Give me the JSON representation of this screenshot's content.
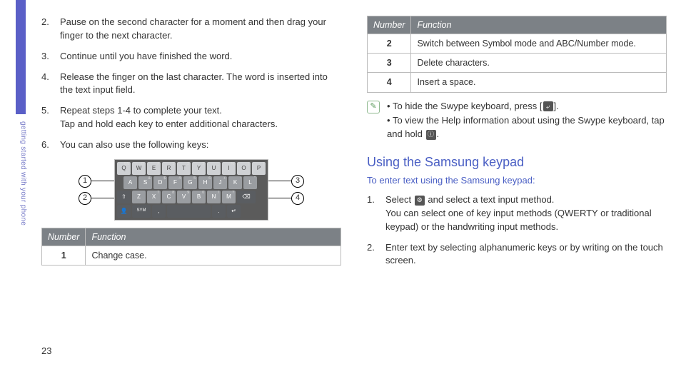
{
  "sidebar": {
    "label": "getting started with your phone"
  },
  "pageNumber": "23",
  "left": {
    "steps": [
      {
        "n": "2.",
        "t": "Pause on the second character for a moment and then drag your finger to the next character."
      },
      {
        "n": "3.",
        "t": "Continue until you have finished the word."
      },
      {
        "n": "4.",
        "t": "Release the finger on the last character. The word is inserted into the text input field."
      },
      {
        "n": "5.",
        "t": "Repeat steps 1-4 to complete your text.\nTap and hold each key to enter additional characters."
      },
      {
        "n": "6.",
        "t": "You can also use the following keys:"
      }
    ],
    "callouts": {
      "c1": "1",
      "c2": "2",
      "c3": "3",
      "c4": "4"
    },
    "table": {
      "hNum": "Number",
      "hFn": "Function",
      "rows": [
        {
          "n": "1",
          "f": "Change case."
        }
      ]
    }
  },
  "right": {
    "table": {
      "hNum": "Number",
      "hFn": "Function",
      "rows": [
        {
          "n": "2",
          "f": "Switch between Symbol mode and ABC/Number mode."
        },
        {
          "n": "3",
          "f": "Delete characters."
        },
        {
          "n": "4",
          "f": "Insert a space."
        }
      ]
    },
    "notes": {
      "a_pre": "To hide the Swype keyboard, press [",
      "a_post": "].",
      "b_pre": "To view the Help information about using the Swype keyboard, tap and hold ",
      "b_post": "."
    },
    "heading": "Using the Samsung keypad",
    "sub": "To enter text using the Samsung keypad:",
    "steps": [
      {
        "n": "1.",
        "pre": "Select ",
        "post": " and select a text input method.\nYou can select one of key input methods (QWERTY or traditional keypad) or the handwriting input methods."
      },
      {
        "n": "2.",
        "t": "Enter text by selecting alphanumeric keys or by writing on the touch screen."
      }
    ]
  },
  "keypad": {
    "r1": [
      {
        "l": "Q",
        "s": "EN"
      },
      {
        "l": "W",
        "s": "@"
      },
      {
        "l": "E",
        "s": "#"
      },
      {
        "l": "R",
        "s": "1"
      },
      {
        "l": "T",
        "s": "2"
      },
      {
        "l": "Y",
        "s": "3"
      },
      {
        "l": "U",
        "s": "_"
      },
      {
        "l": "I",
        "s": "%"
      },
      {
        "l": "O",
        "s": "("
      },
      {
        "l": "P",
        "s": ")"
      }
    ],
    "r2": [
      {
        "l": "A",
        "s": ""
      },
      {
        "l": "S",
        "s": "&"
      },
      {
        "l": "D",
        "s": "$"
      },
      {
        "l": "F",
        "s": "4"
      },
      {
        "l": "G",
        "s": "5"
      },
      {
        "l": "H",
        "s": "6"
      },
      {
        "l": "J",
        "s": "+"
      },
      {
        "l": "K",
        "s": ":"
      },
      {
        "l": "L",
        "s": "\""
      }
    ],
    "r3": [
      {
        "l": "⇧"
      },
      {
        "l": "Z",
        "s": ""
      },
      {
        "l": "X",
        "s": "7"
      },
      {
        "l": "C",
        "s": "8"
      },
      {
        "l": "V",
        "s": "9"
      },
      {
        "l": "B",
        "s": "0"
      },
      {
        "l": "N",
        "s": "/"
      },
      {
        "l": "M",
        "s": "?"
      },
      {
        "l": "⌫"
      }
    ],
    "r4": [
      {
        "l": "👤"
      },
      {
        "l": "SYM"
      },
      {
        "l": ","
      },
      {
        "l": " "
      },
      {
        "l": "."
      },
      {
        "l": "↵"
      }
    ]
  }
}
